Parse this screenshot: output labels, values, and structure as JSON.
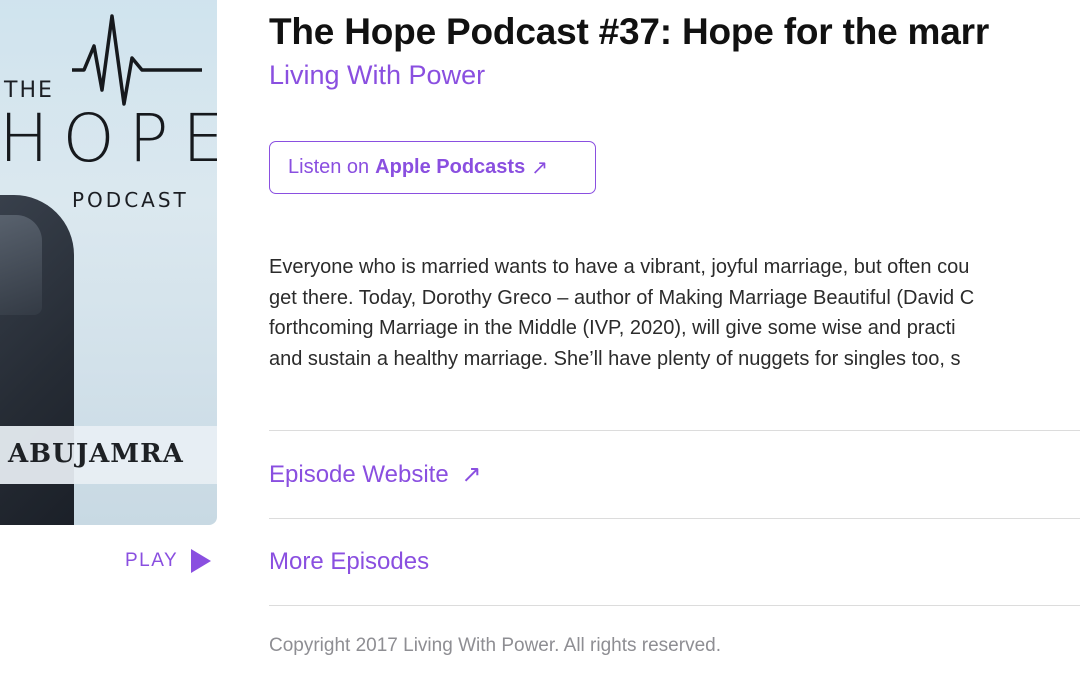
{
  "artwork": {
    "the_text": "THE",
    "hope_text": "HOPE",
    "podcast_text": "PODCAST",
    "author_text": "ABUJAMRA"
  },
  "play": {
    "label": "PLAY",
    "icon": "play-icon"
  },
  "episode": {
    "title": "The Hope Podcast #37: Hope for the marr",
    "show_name": "Living With Power"
  },
  "listen_button": {
    "prefix": "Listen on",
    "brand": "Apple Podcasts",
    "arrow": "↗"
  },
  "description": {
    "lines": [
      "Everyone who is married wants to have a vibrant, joyful marriage, but often cou",
      "get there. Today, Dorothy Greco – author of Making Marriage Beautiful (David C",
      "forthcoming Marriage in the Middle (IVP, 2020), will give some wise and practi",
      "and sustain a healthy marriage. She’ll have plenty of nuggets for singles too, s"
    ]
  },
  "links": {
    "episode_website": "Episode Website",
    "episode_website_arrow": "↗",
    "more_episodes": "More Episodes"
  },
  "copyright": "Copyright 2017 Living With Power. All rights reserved.",
  "colors": {
    "accent": "#8a4fe0",
    "title": "#111111",
    "body": "#2b2b2b",
    "muted": "#8e8e93",
    "divider": "#dcdcdc"
  }
}
